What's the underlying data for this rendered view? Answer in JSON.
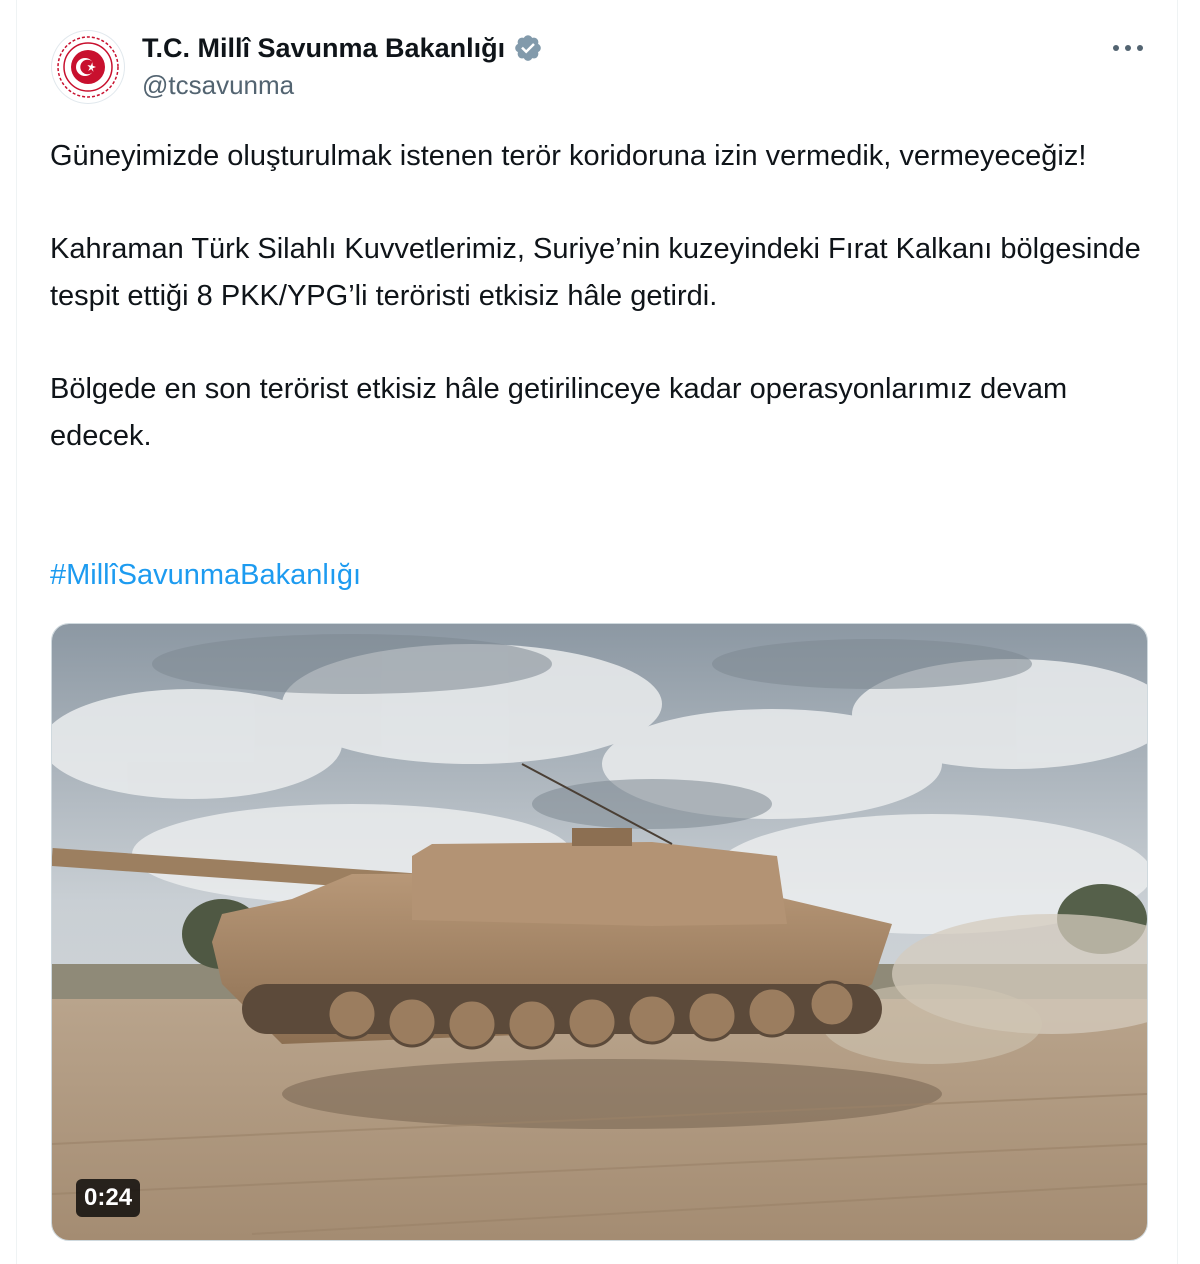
{
  "tweet": {
    "author": {
      "display_name": "T.C. Millî Savunma Bakanlığı",
      "handle": "@tcsavunma",
      "verified": true,
      "avatar_icon": "ministry-emblem-icon",
      "verified_icon": "verified-badge-icon"
    },
    "more_icon": "more-options-icon",
    "paragraphs": [
      "Güneyimizde oluşturulmak istenen terör koridoruna izin vermedik, vermeyeceğiz!",
      "Kahraman Türk Silahlı Kuvvetlerimiz, Suriye’nin kuzeyindeki Fırat Kalkanı bölgesinde tespit ettiği 8 PKK/YPG’li teröristi etkisiz hâle getirdi.",
      "Bölgede en son terörist etkisiz hâle getirilinceye kadar operasyonlarımız devam edecek."
    ],
    "hashtag": "#MillîSavunmaBakanlığı",
    "media": {
      "type": "video",
      "duration": "0:24"
    }
  },
  "colors": {
    "text": "#0f1419",
    "secondary_text": "#536471",
    "link": "#1d9bf0",
    "verified_badge": "#829aab",
    "emblem_red": "#c8102e"
  }
}
